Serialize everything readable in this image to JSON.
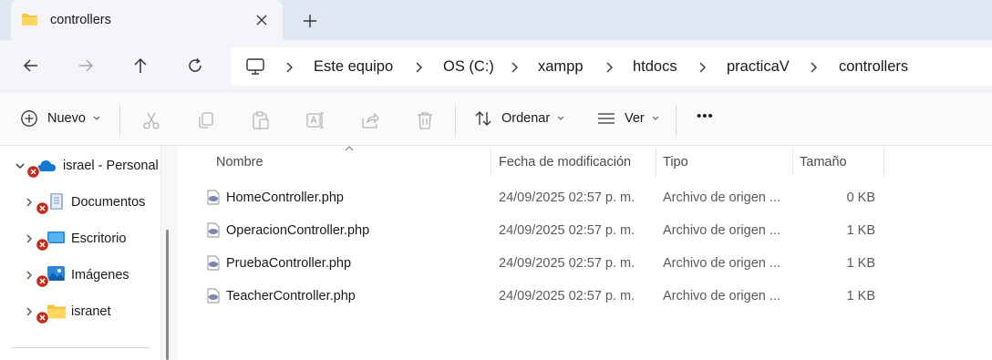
{
  "tab": {
    "title": "controllers",
    "new_tab_glyph": "+"
  },
  "address": {
    "crumbs": [
      "Este equipo",
      "OS (C:)",
      "xampp",
      "htdocs",
      "practicaV",
      "controllers"
    ]
  },
  "toolbar": {
    "new_label": "Nuevo",
    "sort_label": "Ordenar",
    "view_label": "Ver",
    "more_glyph": "•••"
  },
  "sidebar": {
    "items": [
      {
        "label": "israel - Personal",
        "icon": "onedrive-cloud-icon"
      },
      {
        "label": "Documentos",
        "icon": "documents-icon"
      },
      {
        "label": "Escritorio",
        "icon": "desktop-icon"
      },
      {
        "label": "Imágenes",
        "icon": "pictures-icon"
      },
      {
        "label": "isranet",
        "icon": "folder-icon"
      }
    ]
  },
  "columns": {
    "name": "Nombre",
    "modified": "Fecha de modificación",
    "type": "Tipo",
    "size": "Tamaño"
  },
  "files": [
    {
      "name": "HomeController.php",
      "modified": "24/09/2025 02:57 p. m.",
      "type": "Archivo de origen ...",
      "size": "0 KB"
    },
    {
      "name": "OperacionController.php",
      "modified": "24/09/2025 02:57 p. m.",
      "type": "Archivo de origen ...",
      "size": "1 KB"
    },
    {
      "name": "PruebaController.php",
      "modified": "24/09/2025 02:57 p. m.",
      "type": "Archivo de origen ...",
      "size": "1 KB"
    },
    {
      "name": "TeacherController.php",
      "modified": "24/09/2025 02:57 p. m.",
      "type": "Archivo de origen ...",
      "size": "1 KB"
    }
  ],
  "colors": {
    "accent": "#0067c0",
    "folder": "#f4c542",
    "error": "#c42b1c",
    "php": "#7a86b8"
  }
}
